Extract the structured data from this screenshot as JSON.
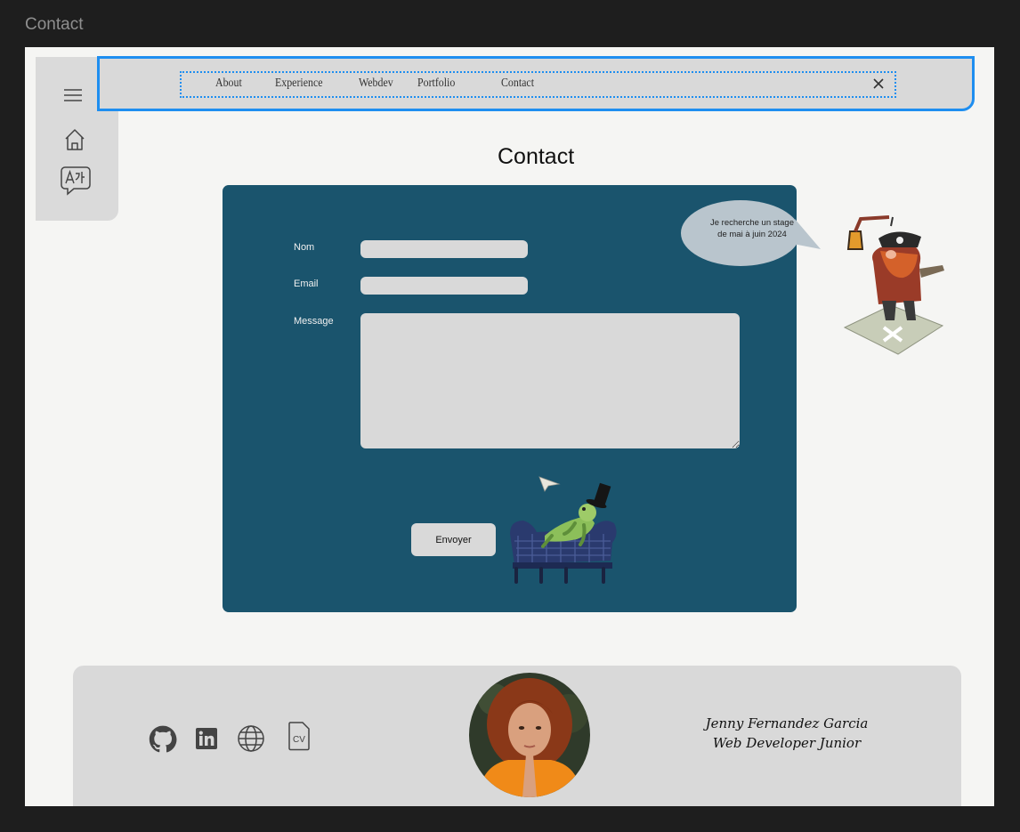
{
  "frame": {
    "label": "Contact"
  },
  "nav": {
    "links": [
      "About",
      "Experience",
      "Webdev",
      "Portfolio",
      "Contact"
    ]
  },
  "page": {
    "title": "Contact"
  },
  "form": {
    "name_label": "Nom",
    "email_label": "Email",
    "message_label": "Message",
    "submit_label": "Envoyer"
  },
  "bubble": {
    "line1": "Je recherche un stage",
    "line2": "de mai à juin 2024"
  },
  "footer": {
    "icons": [
      "github-icon",
      "linkedin-icon",
      "globe-icon",
      "cv-icon"
    ],
    "cv_text": "CV",
    "name": "Jenny Fernandez Garcia",
    "role": "Web Developer Junior"
  },
  "colors": {
    "panel": "#1a546d",
    "selection": "#1e8ef0",
    "field": "#d9d9d9"
  }
}
